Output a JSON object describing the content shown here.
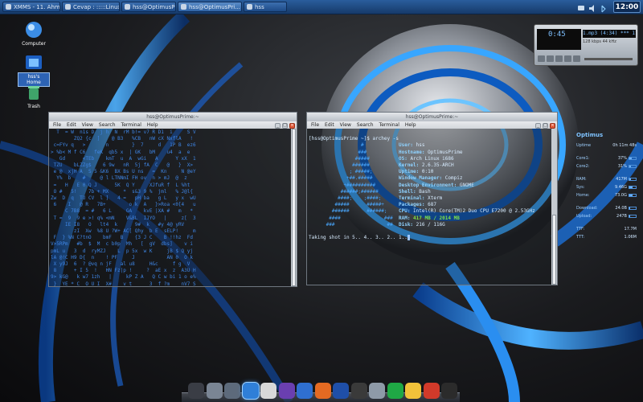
{
  "panel": {
    "tasks": [
      {
        "label": "XMMS - 11. Ahm...",
        "active": false
      },
      {
        "label": "Cevap : :::::Linux...",
        "active": false
      },
      {
        "label": "hss@OptimusPri...",
        "active": false
      },
      {
        "label": "hss@OptimusPri...",
        "active": true
      },
      {
        "label": "hss",
        "active": false
      }
    ],
    "clock": "12:00"
  },
  "desktop_icons": [
    {
      "label": "Computer",
      "icon": "computer-icon"
    },
    {
      "label": "hss's Home",
      "icon": "home-folder-icon"
    },
    {
      "label": "Trash",
      "icon": "trash-icon"
    }
  ],
  "xmms": {
    "time": "0:45",
    "track": "1.mp3 (4:34) *** 11. A",
    "kbps": "128",
    "khz": "44"
  },
  "matrix_window": {
    "title": "hss@OptimusPrime:~",
    "menu": [
      "File",
      "Edit",
      "View",
      "Search",
      "Terminal",
      "Help"
    ]
  },
  "neofetch_window": {
    "title": "hss@OptimusPrime:~",
    "menu": [
      "File",
      "Edit",
      "View",
      "Search",
      "Terminal",
      "Help"
    ],
    "prompt": "[hss@OptimusPrime ~]$ archey -s",
    "info": [
      {
        "k": "User:",
        "v": "hss"
      },
      {
        "k": "Hostname:",
        "v": "OptimusPrime"
      },
      {
        "k": "OS:",
        "v": "Arch Linux i686"
      },
      {
        "k": "Kernel:",
        "v": "2.6.35-ARCH"
      },
      {
        "k": "Uptime:",
        "v": "0:10"
      },
      {
        "k": "Window Manager:",
        "v": "Compiz"
      },
      {
        "k": "Desktop Environment:",
        "v": "GNOME"
      },
      {
        "k": "Shell:",
        "v": "Bash"
      },
      {
        "k": "Terminal:",
        "v": "Xterm"
      },
      {
        "k": "Packages:",
        "v": "687"
      },
      {
        "k": "CPU:",
        "v": "Intel(R) Core(TM)2 Duo CPU E7200 @ 2.53GHz"
      },
      {
        "k": "RAM:",
        "v": "417 MB / 2014 MB"
      },
      {
        "k": "Disk:",
        "v": "216 / 116G"
      }
    ],
    "shot_line": "Taking shot in 5.. 4.. 3.. 2.. 1.."
  },
  "conky": {
    "title": "Optimus",
    "rows": [
      {
        "label": "Uptime",
        "value": "0h 11m 48s",
        "pct": null
      },
      {
        "label": "Core1:",
        "value": "37%",
        "pct": 37
      },
      {
        "label": "Core2:",
        "value": "31%",
        "pct": 31
      },
      {
        "label": "RAM:",
        "value": "417M",
        "pct": 21
      },
      {
        "label": "Sys:",
        "value": "9.46G",
        "pct": 45
      },
      {
        "label": "Home:",
        "value": "73.0G",
        "pct": 55
      },
      {
        "label": "Download:",
        "value": "24.0B",
        "pct": 10
      },
      {
        "label": "Upload:",
        "value": "247B",
        "pct": 8
      },
      {
        "label": "TTF:",
        "value": "17.7M",
        "pct": null
      },
      {
        "label": "TTT:",
        "value": "1.06M",
        "pct": null
      }
    ]
  },
  "dock_items": [
    "app-icon",
    "folder-icon",
    "file-manager-icon",
    "pidgin-icon",
    "rhythmbox-icon",
    "settings-icon",
    "tux-icon",
    "firefox-icon",
    "media-player-icon",
    "music-icon",
    "screenshot-icon",
    "utorrent-icon",
    "weather-icon",
    "gmail-icon",
    "terminal-icon"
  ],
  "colors": {
    "panel": "#1d4a86",
    "accent": "#3f86e6",
    "matrix_green_blue": "#3f86e6",
    "ram_value": "#7ee04a"
  }
}
